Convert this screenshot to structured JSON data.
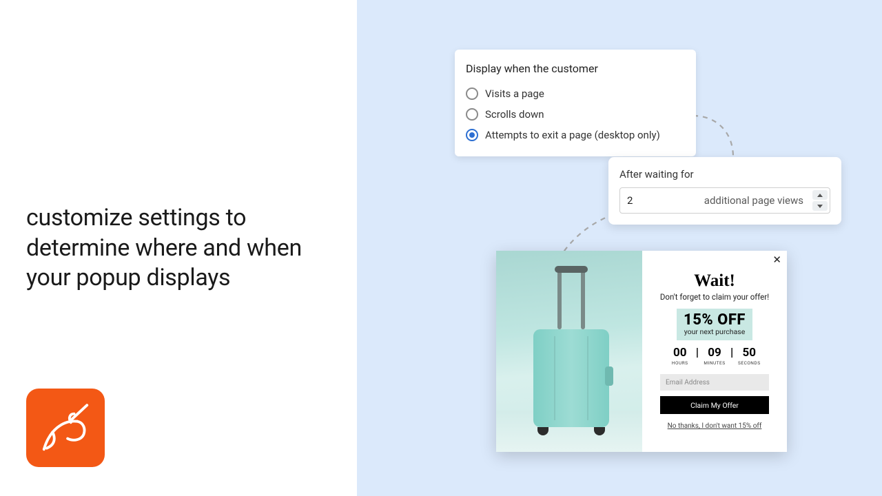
{
  "headline": "customize settings to determine where and when your popup displays",
  "card1": {
    "title": "Display when the customer",
    "options": [
      {
        "label": "Visits a page",
        "selected": false
      },
      {
        "label": "Scrolls down",
        "selected": false
      },
      {
        "label": "Attempts to exit a page (desktop only)",
        "selected": true
      }
    ]
  },
  "card2": {
    "title": "After waiting for",
    "value": "2",
    "suffix": "additional page views"
  },
  "popup": {
    "wait": "Wait!",
    "subtitle": "Don't forget to claim your offer!",
    "offer_big": "15% OFF",
    "offer_small": "your next purchase",
    "timer": {
      "hours": "00",
      "minutes": "09",
      "seconds": "50",
      "hours_label": "HOURS",
      "minutes_label": "MINUTES",
      "seconds_label": "SECONDS"
    },
    "email_placeholder": "Email Address",
    "cta": "Claim My Offer",
    "decline": "No thanks, I don't want 15% off"
  },
  "colors": {
    "accent": "#2d6fd2",
    "brand": "#f35815",
    "bg_right": "#dbe9fb"
  }
}
